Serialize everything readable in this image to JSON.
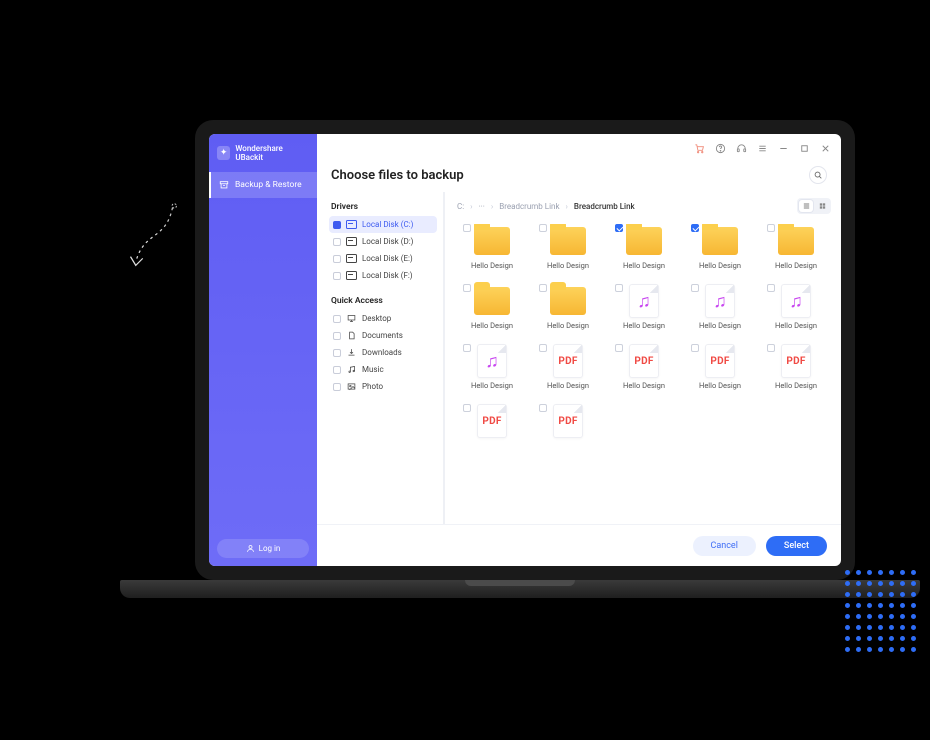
{
  "sidebar": {
    "brand": "Wondershare UBackit",
    "items": [
      {
        "label": "Backup & Restore"
      }
    ],
    "login_label": "Log in"
  },
  "header": {
    "title": "Choose files to backup"
  },
  "tree": {
    "sections": [
      {
        "title": "Drivers",
        "items": [
          {
            "label": "Local Disk (C:)",
            "active": true
          },
          {
            "label": "Local Disk (D:)"
          },
          {
            "label": "Local Disk (E:)"
          },
          {
            "label": "Local Disk (F:)"
          }
        ]
      },
      {
        "title": "Quick Access",
        "items": [
          {
            "label": "Desktop"
          },
          {
            "label": "Documents"
          },
          {
            "label": "Downloads"
          },
          {
            "label": "Music"
          },
          {
            "label": "Photo"
          }
        ]
      }
    ]
  },
  "breadcrumbs": [
    "C:",
    "···",
    "Breadcrumb Link",
    "Breadcrumb Link"
  ],
  "files": [
    {
      "type": "folder",
      "label": "Hello Design",
      "checked": false
    },
    {
      "type": "folder",
      "label": "Hello Design",
      "checked": false
    },
    {
      "type": "folder",
      "label": "Hello Design",
      "checked": true
    },
    {
      "type": "folder",
      "label": "Hello Design",
      "checked": true
    },
    {
      "type": "folder",
      "label": "Hello Design",
      "checked": false
    },
    {
      "type": "folder",
      "label": "Hello Design",
      "checked": false
    },
    {
      "type": "folder",
      "label": "Hello Design",
      "checked": false
    },
    {
      "type": "music",
      "label": "Hello Design",
      "checked": false
    },
    {
      "type": "music",
      "label": "Hello Design",
      "checked": false
    },
    {
      "type": "music",
      "label": "Hello Design",
      "checked": false
    },
    {
      "type": "music",
      "label": "Hello Design",
      "checked": false
    },
    {
      "type": "pdf",
      "label": "Hello Design",
      "checked": false
    },
    {
      "type": "pdf",
      "label": "Hello Design",
      "checked": false
    },
    {
      "type": "pdf",
      "label": "Hello Design",
      "checked": false
    },
    {
      "type": "pdf",
      "label": "Hello Design",
      "checked": false
    },
    {
      "type": "pdf",
      "label": "",
      "checked": false
    },
    {
      "type": "pdf",
      "label": "",
      "checked": false
    }
  ],
  "footer": {
    "cancel_label": "Cancel",
    "select_label": "Select"
  },
  "file_type_text": {
    "pdf": "PDF",
    "music": "♫"
  }
}
